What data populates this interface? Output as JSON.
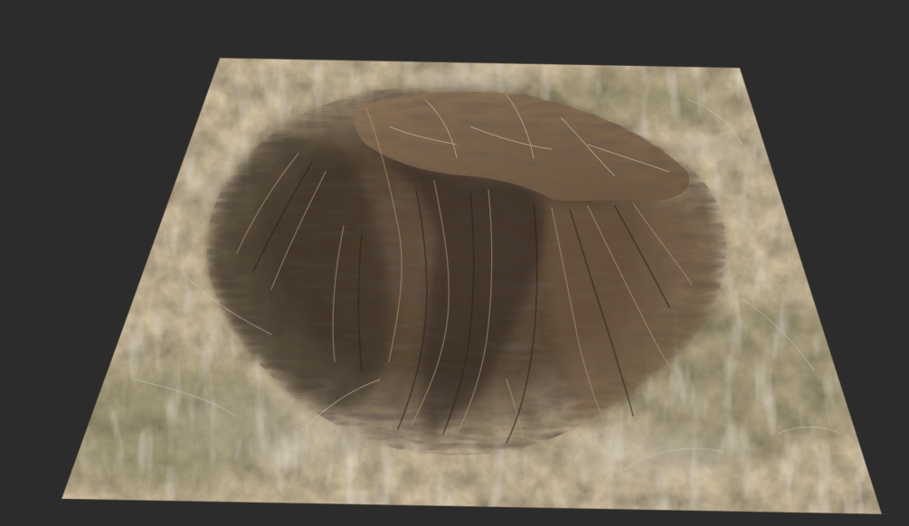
{
  "scene": {
    "background_color": "#2c2c2c",
    "subject": "terrain-mesh",
    "colors": {
      "ground": "#6f5f48",
      "ground_green": "#5f5d40",
      "rock_dark": "#3a2e24",
      "rock_mid": "#5a4533",
      "rock_light": "#8a735b",
      "ridge_highlight": "#a89478",
      "sediment_light": "#b9b2a6"
    }
  }
}
